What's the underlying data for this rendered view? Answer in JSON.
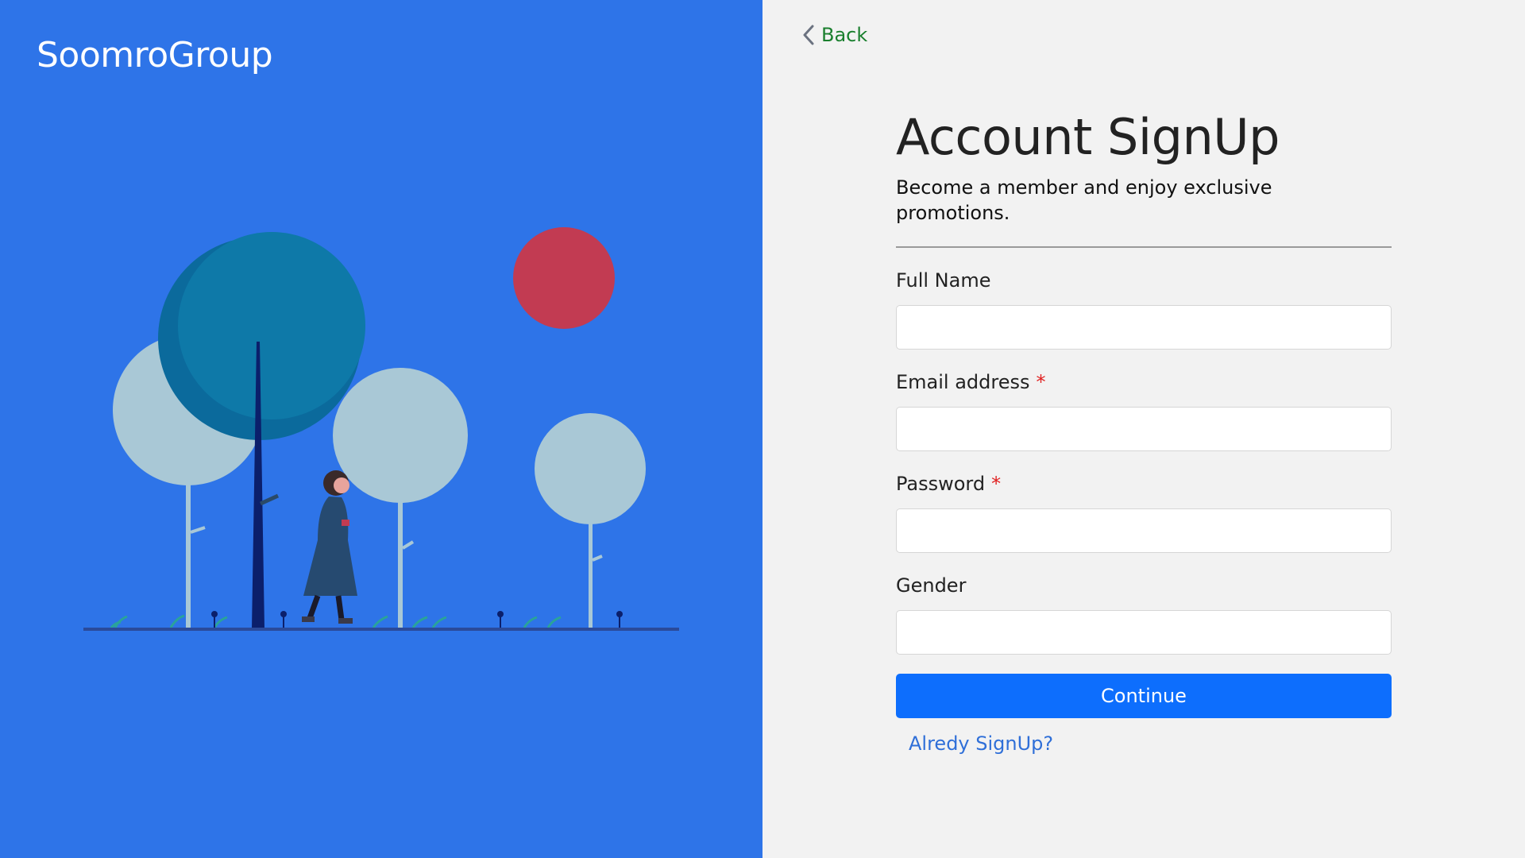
{
  "brand": {
    "name": "SoomroGroup"
  },
  "nav": {
    "back_label": "Back"
  },
  "form": {
    "title": "Account SignUp",
    "subtitle": "Become a member and enjoy exclusive promotions.",
    "fields": [
      {
        "label": "Full Name",
        "required": false,
        "value": "",
        "required_mark": ""
      },
      {
        "label": "Email address",
        "required": true,
        "value": "",
        "required_mark": "*"
      },
      {
        "label": "Password",
        "required": true,
        "value": "",
        "required_mark": "*"
      },
      {
        "label": "Gender",
        "required": false,
        "value": "",
        "required_mark": ""
      }
    ],
    "submit_label": "Continue",
    "signin_link": "Alredy SignUp?"
  },
  "colors": {
    "left_panel_bg": "#2e74e8",
    "right_panel_bg": "#f2f2f2",
    "primary_button": "#0d6efd",
    "back_link": "#1a7f2e",
    "link": "#2f6fd8",
    "required_mark": "#e02020",
    "sun": "#c23b52",
    "tree_dark": "#0e79a8",
    "tree_light": "#a9c8d6"
  },
  "illustration": {
    "icon": "woman-walking-among-trees-illustration"
  }
}
